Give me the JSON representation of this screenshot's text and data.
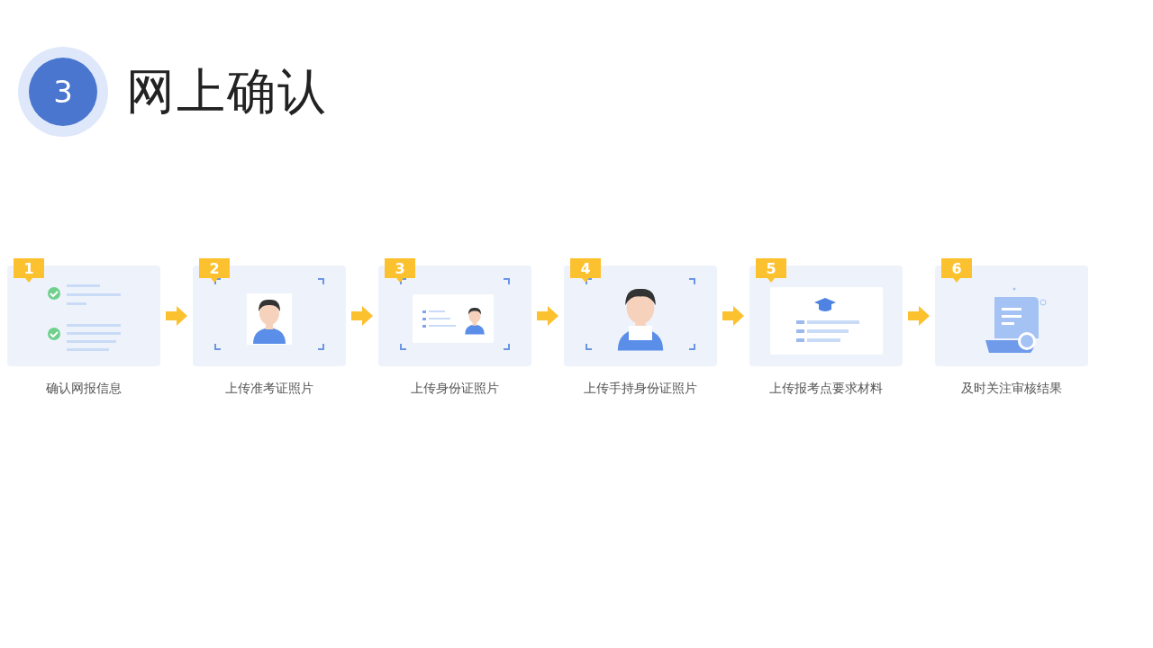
{
  "section": {
    "number": "3",
    "title": "网上确认"
  },
  "steps": [
    {
      "number": "1",
      "label": "确认网报信息",
      "kind": "checklist"
    },
    {
      "number": "2",
      "label": "上传准考证照片",
      "kind": "photo"
    },
    {
      "number": "3",
      "label": "上传身份证照片",
      "kind": "id-card"
    },
    {
      "number": "4",
      "label": "上传手持身份证照片",
      "kind": "holding-card"
    },
    {
      "number": "5",
      "label": "上传报考点要求材料",
      "kind": "materials"
    },
    {
      "number": "6",
      "label": "及时关注审核结果",
      "kind": "scroll"
    }
  ]
}
